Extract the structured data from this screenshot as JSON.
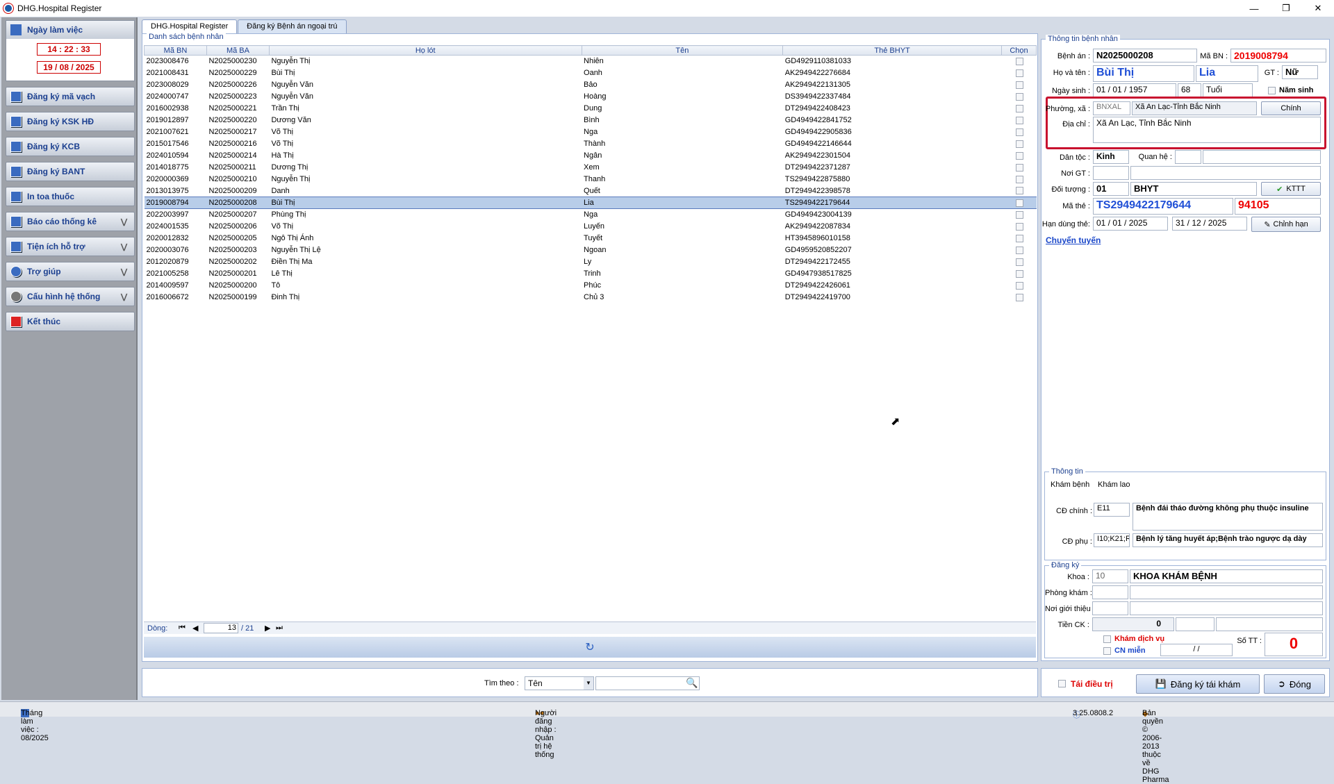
{
  "window": {
    "title": "DHG.Hospital Register"
  },
  "sidebar": {
    "workday_label": "Ngày làm việc",
    "time": "14 : 22 : 33",
    "date": "19 / 08 / 2025",
    "items": [
      "Đăng ký mã vạch",
      "Đăng ký KSK HĐ",
      "Đăng ký KCB",
      "Đăng ký BANT",
      "In toa thuốc",
      "Báo cáo thống kê",
      "Tiện ích hỗ trợ",
      "Trợ giúp",
      "Cấu hình hệ thống",
      "Kết thúc"
    ]
  },
  "tabs": [
    "DHG.Hospital Register",
    "Đăng ký Bệnh án ngoại trú"
  ],
  "patient_list": {
    "group_label": "Danh sách bệnh nhân",
    "columns": [
      "Mã BN",
      "Mã BA",
      "Họ lót",
      "Tên",
      "Thẻ BHYT",
      "Chọn"
    ],
    "rows": [
      [
        "2023008476",
        "N2025000230",
        "Nguyễn Thị",
        "Nhiên",
        "GD4929110381033"
      ],
      [
        "2021008431",
        "N2025000229",
        "Bùi Thị",
        "Oanh",
        "AK2949422276684"
      ],
      [
        "2023008029",
        "N2025000226",
        "Nguyễn Văn",
        "Bảo",
        "AK2949422131305"
      ],
      [
        "2024000747",
        "N2025000223",
        "Nguyễn Văn",
        "Hoàng",
        "DS3949422337484"
      ],
      [
        "2016002938",
        "N2025000221",
        "Trần Thị",
        "Dung",
        "DT2949422408423"
      ],
      [
        "2019012897",
        "N2025000220",
        "Dương Văn",
        "Bình",
        "GD4949422841752"
      ],
      [
        "2021007621",
        "N2025000217",
        "Võ Thị",
        "Nga",
        "GD4949422905836"
      ],
      [
        "2015017546",
        "N2025000216",
        "Võ Thị",
        "Thành",
        "GD4949422146644"
      ],
      [
        "2024010594",
        "N2025000214",
        "Hà Thị",
        "Ngân",
        "AK2949422301504"
      ],
      [
        "2014018775",
        "N2025000211",
        "Dương Thị",
        "Xem",
        "DT2949422371287"
      ],
      [
        "2020000369",
        "N2025000210",
        "Nguyễn Thị",
        "Thanh",
        "TS2949422875880"
      ],
      [
        "2013013975",
        "N2025000209",
        "Danh",
        "Quết",
        "DT2949422398578"
      ],
      [
        "2019008794",
        "N2025000208",
        "Bùi Thị",
        "Lia",
        "TS2949422179644"
      ],
      [
        "2022003997",
        "N2025000207",
        "Phùng Thị",
        "Nga",
        "GD4949423004139"
      ],
      [
        "2024001535",
        "N2025000206",
        "Võ Thị",
        "Luyến",
        "AK2949422087834"
      ],
      [
        "2020012832",
        "N2025000205",
        "Ngô Thị Ánh",
        "Tuyết",
        "HT3945896010158"
      ],
      [
        "2020003076",
        "N2025000203",
        "Nguyễn Thị Lệ",
        "Ngoan",
        "GD4959520852207"
      ],
      [
        "2012020879",
        "N2025000202",
        "Điền Thị Ma",
        "Ly",
        "DT2949422172455"
      ],
      [
        "2021005258",
        "N2025000201",
        "Lê Thị",
        "Trinh",
        "GD4947938517825"
      ],
      [
        "2014009597",
        "N2025000200",
        "Tô",
        "Phúc",
        "DT2949422426061"
      ],
      [
        "2016006672",
        "N2025000199",
        "Đinh Thị",
        "Chủ 3",
        "DT2949422419700"
      ]
    ],
    "selected_index": 12,
    "pager": {
      "label": "Dòng:",
      "current": "13",
      "total": "/ 21"
    }
  },
  "search": {
    "label": "Tìm theo :",
    "mode": "Tên",
    "value": ""
  },
  "patient_info": {
    "group_label": "Thông tin bệnh nhân",
    "benh_an_label": "Bệnh án :",
    "benh_an": "N2025000208",
    "ma_bn_label": "Mã BN :",
    "ma_bn": "2019008794",
    "ho_ten_label": "Họ và tên :",
    "ho": "Bùi Thị",
    "ten": "Lia",
    "gt_label": "GT :",
    "gt": "Nữ",
    "ngay_sinh_label": "Ngày sinh :",
    "ngay_sinh": "01 / 01 / 1957",
    "tuoi": "68",
    "tuoi_unit": "Tuổi",
    "nam_sinh": "Năm sinh",
    "phuong_label": "Phường, xã :",
    "phuong_code": "BNXAL",
    "phuong": "Xã An Lạc-Tỉnh Bắc Ninh",
    "chinh_btn": "Chính",
    "dia_chi_label": "Địa chỉ :",
    "dia_chi": "Xã An Lạc, Tỉnh Bắc Ninh",
    "dan_toc_label": "Dân tộc :",
    "dan_toc": "Kinh",
    "quan_he_label": "Quan hệ :",
    "noi_gt_label": "Nơi GT :",
    "doi_tuong_label": "Đối tượng :",
    "doi_tuong_code": "01",
    "doi_tuong": "BHYT",
    "kttt_btn": "KTTT",
    "ma_the_label": "Mã thẻ :",
    "ma_the": "TS2949422179644",
    "ma_kcb": "94105",
    "han_label": "Hạn dùng thẻ:",
    "han_tu": "01 / 01 / 2025",
    "han_den": "31 / 12 / 2025",
    "chinh_han_btn": "Chỉnh hạn",
    "chuyen_tuyen": "Chuyển tuyến"
  },
  "thong_tin": {
    "group_label": "Thông tin",
    "tabs": [
      "Khám bệnh",
      "Khám lao"
    ],
    "cd_chinh_label": "CĐ chính :",
    "cd_chinh_code": "E11",
    "cd_chinh": "Bệnh đái tháo đường không phụ thuộc insuline",
    "cd_phu_label": "CĐ phụ :",
    "cd_phu_code": "I10;K21;R",
    "cd_phu": "Bệnh lý tăng huyết áp;Bệnh trào ngược dạ dày"
  },
  "dang_ky": {
    "group_label": "Đăng ký",
    "khoa_label": "Khoa :",
    "khoa_code": "10",
    "khoa": "KHOA KHÁM BỆNH",
    "phong_label": "Phòng khám :",
    "noi_gt_label": "Nơi giới thiệu :",
    "tien_ck_label": "Tiền CK :",
    "tien_ck": "0",
    "kham_dv": "Khám dịch vụ",
    "cn_mien": "CN miễn",
    "cn_date": "/ /",
    "so_tt_label": "Số TT :",
    "so_tt": "0"
  },
  "actions": {
    "tai_dieu_tri": "Tái điều trị",
    "dang_ky_tai_kham": "Đăng ký tái khám",
    "dong": "Đóng"
  },
  "status": {
    "thang": "Tháng làm việc : 08/2025",
    "nguoi": "Người đăng nhập : Quản trị hệ thống",
    "version": "3.25.0808.2",
    "copyright": "Bản quyền © 2006-2013 thuộc về DHG Pharma"
  }
}
